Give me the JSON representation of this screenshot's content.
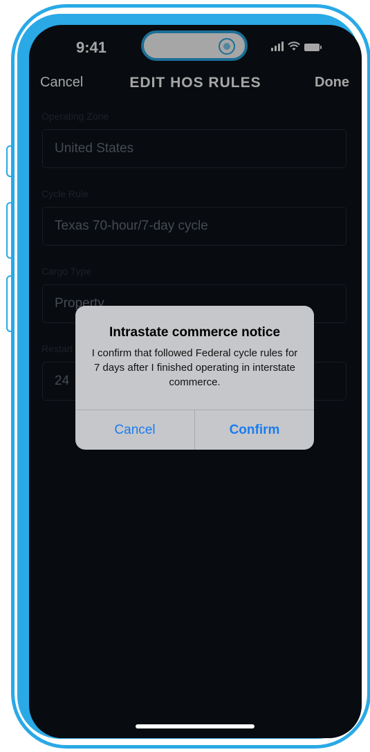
{
  "status": {
    "time": "9:41"
  },
  "nav": {
    "cancel": "Cancel",
    "title": "EDIT HOS RULES",
    "done": "Done"
  },
  "form": {
    "zone_label": "Operating Zone",
    "zone_value": "United States",
    "cycle_label": "Cycle Rule",
    "cycle_value": "Texas 70-hour/7-day cycle",
    "cargo_label": "Cargo Type",
    "cargo_value": "Property",
    "restart_label": "Restart",
    "restart_value": "24"
  },
  "alert": {
    "title": "Intrastate commerce notice",
    "message": "I confirm that followed Federal cycle rules for 7 days after I finished operating in interstate commerce.",
    "cancel": "Cancel",
    "confirm": "Confirm"
  },
  "colors": {
    "frame": "#2aa9e6",
    "screen": "#0d1117",
    "accent": "#1a7cf0",
    "alert_bg": "#c6c7ca"
  }
}
